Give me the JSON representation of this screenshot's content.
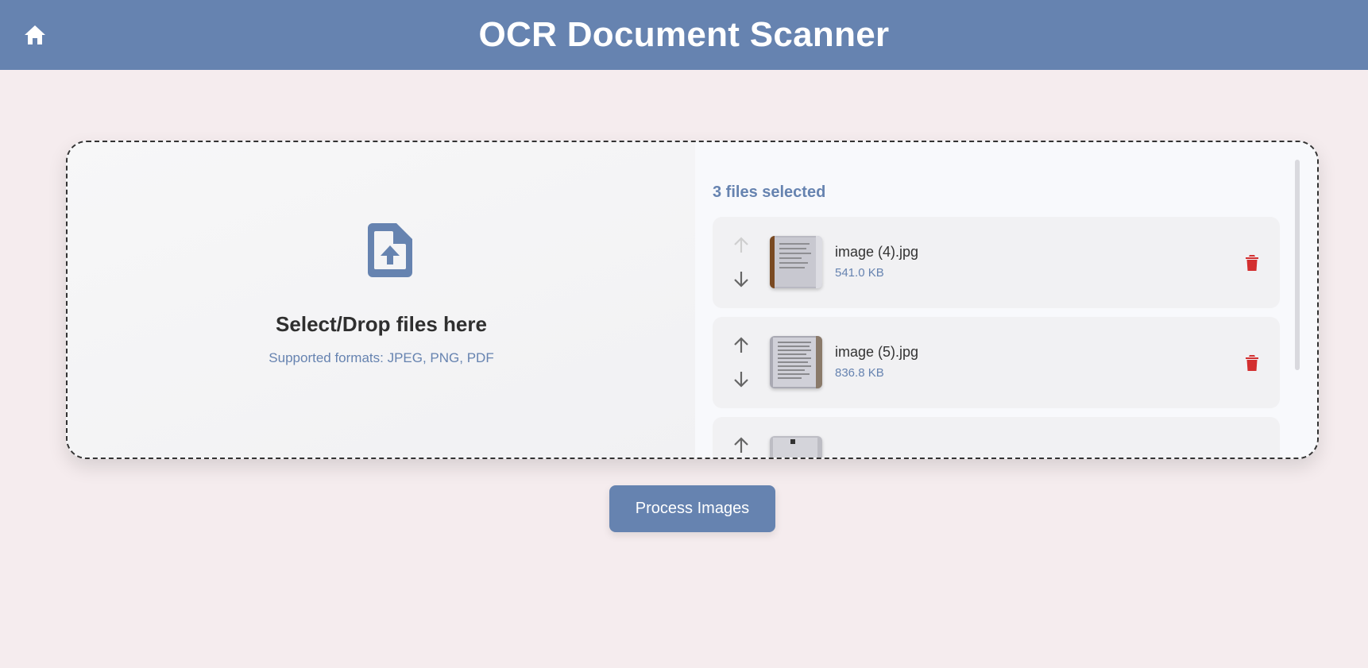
{
  "header": {
    "title": "OCR Document Scanner",
    "home_icon": "home-icon",
    "background": "#6683b0"
  },
  "dropzone": {
    "icon": "file-upload-icon",
    "title": "Select/Drop files here",
    "subtitle": "Supported formats: JPEG, PNG, PDF"
  },
  "file_list": {
    "count_label": "3 files selected",
    "files": [
      {
        "name": "image (4).jpg",
        "size": "541.0 KB",
        "move_up_enabled": false,
        "move_down_enabled": true
      },
      {
        "name": "image (5).jpg",
        "size": "836.8 KB",
        "move_up_enabled": true,
        "move_down_enabled": true
      },
      {
        "name": "",
        "size": "",
        "move_up_enabled": true,
        "move_down_enabled": true
      }
    ]
  },
  "actions": {
    "process_label": "Process Images"
  },
  "colors": {
    "accent": "#6683b0",
    "page_background": "#f5ecee",
    "delete": "#d32f2f",
    "arrow": "#666666",
    "arrow_disabled": "#cfcfcf"
  }
}
